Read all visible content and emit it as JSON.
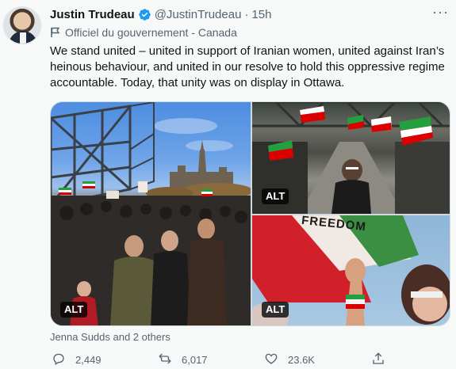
{
  "author": {
    "name": "Justin Trudeau",
    "handle": "@JustinTrudeau",
    "separator": "·",
    "time": "15h",
    "label": "Officiel du gouvernement - Canada",
    "avatar_icon": "profile-photo",
    "verified_icon": "verified-badge-icon"
  },
  "tweet": {
    "text": "We stand united – united in support of Iranian women, united against Iran’s heinous behaviour, and united in our resolve to hold this oppressive regime accountable. Today, that unity was on display in Ottawa."
  },
  "media": {
    "images": [
      {
        "alt_badge": "ALT"
      },
      {
        "alt_badge": "ALT"
      },
      {
        "alt_badge": "ALT",
        "banner_text": "FREEDOM"
      }
    ]
  },
  "tagged": "Jenna Sudds and 2 others",
  "actions": {
    "reply_count": "2,449",
    "retweet_count": "6,017",
    "like_count": "23.6K"
  },
  "colors": {
    "background": "#f7f9f9",
    "text_primary": "#0f1419",
    "text_secondary": "#536471",
    "verified_blue": "#1d9bf0",
    "iran_green": "#239f40",
    "iran_red": "#da0000"
  }
}
